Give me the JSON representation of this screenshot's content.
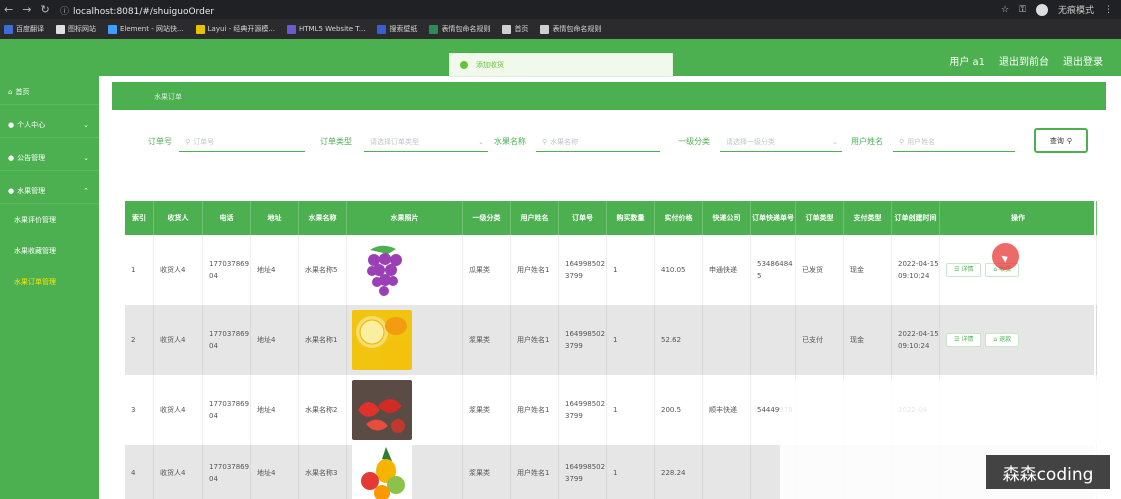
{
  "browser": {
    "url": "localhost:8081/#/shuiguoOrder",
    "profile_label": "无痕模式",
    "bookmarks": [
      {
        "label": "百度翻译",
        "color": "#3f6cd9"
      },
      {
        "label": "图标网站",
        "color": "#e0e0e0"
      },
      {
        "label": "Element - 网站快...",
        "color": "#409eff"
      },
      {
        "label": "Layui - 经典开源模...",
        "color": "#e6c200"
      },
      {
        "label": "HTML5 Website T...",
        "color": "#6a5acd"
      },
      {
        "label": "搜索壁纸",
        "color": "#3a5fcd"
      },
      {
        "label": "表情包命名规则",
        "color": "#2e8b57"
      },
      {
        "label": "首页",
        "color": "#cfcfcf"
      },
      {
        "label": "表情包命名规则",
        "color": "#cfcfcf"
      }
    ]
  },
  "header": {
    "user_label": "用户 a1",
    "backend_link": "退出到前台",
    "logout_link": "退出登录",
    "toast_text": "添加收货"
  },
  "sidebar": {
    "home": "首页",
    "personal": "个人中心",
    "notice": "公告管理",
    "fruit": "水果管理",
    "sub_items": [
      "水果评价管理",
      "水果收藏管理",
      "水果订单管理"
    ]
  },
  "breadcrumb": "水果订单",
  "filters": {
    "order_no_label": "订单号",
    "order_no_placeholder": "订单号",
    "order_type_label": "订单类型",
    "order_type_placeholder": "请选择订单类型",
    "fruit_name_label": "水果名称",
    "fruit_name_placeholder": "水果名称",
    "category_label": "一级分类",
    "category_placeholder": "请选择一级分类",
    "username_label": "用户姓名",
    "username_placeholder": "用户姓名",
    "search_label": "查询"
  },
  "table": {
    "headers": [
      "索引",
      "收货人",
      "电话",
      "地址",
      "水果名称",
      "水果照片",
      "一级分类",
      "用户姓名",
      "订单号",
      "购买数量",
      "实付价格",
      "快递公司",
      "订单快递单号",
      "订单类型",
      "支付类型",
      "订单创建时间",
      "操作"
    ],
    "rows": [
      {
        "index": "1",
        "receiver": "收货人4",
        "phone": "17703786904",
        "address": "地址4",
        "fruit": "水果名称5",
        "photo": "grape",
        "category": "瓜果类",
        "username": "用户姓名1",
        "order_no": "1649985023799",
        "qty": "1",
        "price": "410.05",
        "express": "申通快递",
        "tracking": "534864845",
        "order_type": "已发货",
        "pay_type": "现金",
        "created": "2022-04-15 09:10:24",
        "ops": [
          "详情",
          "收货"
        ]
      },
      {
        "index": "2",
        "receiver": "收货人4",
        "phone": "17703786904",
        "address": "地址4",
        "fruit": "水果名称1",
        "photo": "lemon",
        "category": "浆果类",
        "username": "用户姓名1",
        "order_no": "1649985023799",
        "qty": "1",
        "price": "52.62",
        "express": "",
        "tracking": "",
        "order_type": "已支付",
        "pay_type": "现金",
        "created": "2022-04-15 09:10:24",
        "ops": [
          "详情",
          "退款"
        ]
      },
      {
        "index": "3",
        "receiver": "收货人4",
        "phone": "17703786904",
        "address": "地址4",
        "fruit": "水果名称2",
        "photo": "strawberry",
        "category": "浆果类",
        "username": "用户姓名1",
        "order_no": "1649985023799",
        "qty": "1",
        "price": "200.5",
        "express": "顺丰快递",
        "tracking": "54449978",
        "order_type": "",
        "pay_type": "",
        "created": "2022-04",
        "ops": []
      },
      {
        "index": "4",
        "receiver": "收货人4",
        "phone": "17703786904",
        "address": "地址4",
        "fruit": "水果名称3",
        "photo": "mixed",
        "category": "浆果类",
        "username": "用户姓名1",
        "order_no": "1649985023799",
        "qty": "1",
        "price": "228.24",
        "express": "",
        "tracking": "",
        "order_type": "",
        "pay_type": "",
        "created": "",
        "ops": []
      }
    ]
  },
  "watermark": "森森coding",
  "colors": {
    "primary": "#4caf50",
    "active_menu": "#ffe600",
    "toast": "#67c23a"
  }
}
